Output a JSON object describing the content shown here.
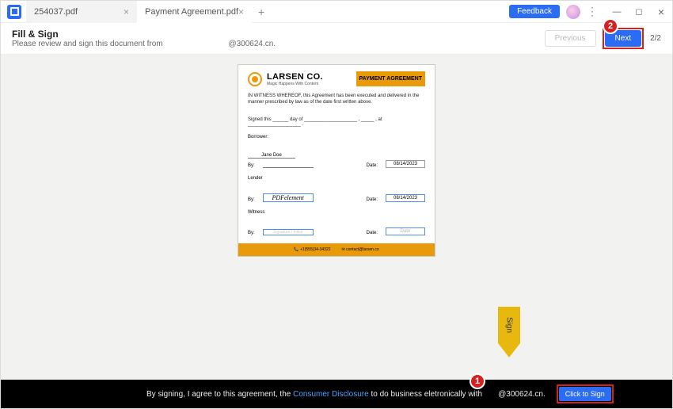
{
  "tabs": [
    {
      "label": "254037.pdf",
      "active": false
    },
    {
      "label": "Payment Agreement.pdf",
      "active": true
    }
  ],
  "feedback_label": "Feedback",
  "header": {
    "title": "Fill & Sign",
    "subtitle_prefix": "Please review and sign this document from",
    "subtitle_domain": "@300624.cn.",
    "prev_label": "Previous",
    "next_label": "Next",
    "pager": "2/2"
  },
  "doc": {
    "company": "LARSEN CO.",
    "tagline": "Magic Happens With Content",
    "badge": "PAYMENT AGREEMENT",
    "witness_text": "IN WITNESS WHEREOF, this Agreement has been executed and delivered in the manner prescribed by law as of the date first written above.",
    "signed_line": "Signed this ______ day of ____________________ , _____ , at ____________________ .",
    "borrower_label": "Borrower:",
    "borrower_name": "Jane Doe",
    "by_label": "By:",
    "date_label": "Date:",
    "borrower_date": "08/14/2023",
    "lender_label": "Lender",
    "lender_sig": "PDFelement",
    "lender_date": "08/14/2023",
    "witness_label": "Witness",
    "witness_sig": "Signature / Initial",
    "witness_date": "Date",
    "footer_phone": "+1(555)34-34322",
    "footer_email": "contact@larsen.co"
  },
  "sign_arrow": "Sign",
  "footer": {
    "agree_prefix": "By signing, I agree to this agreement, the ",
    "disclosure": "Consumer Disclosure",
    "agree_suffix": " to do business eletronically with",
    "domain": "@300624.cn.",
    "cts": "Click to Sign"
  },
  "callouts": {
    "one": "1",
    "two": "2"
  }
}
